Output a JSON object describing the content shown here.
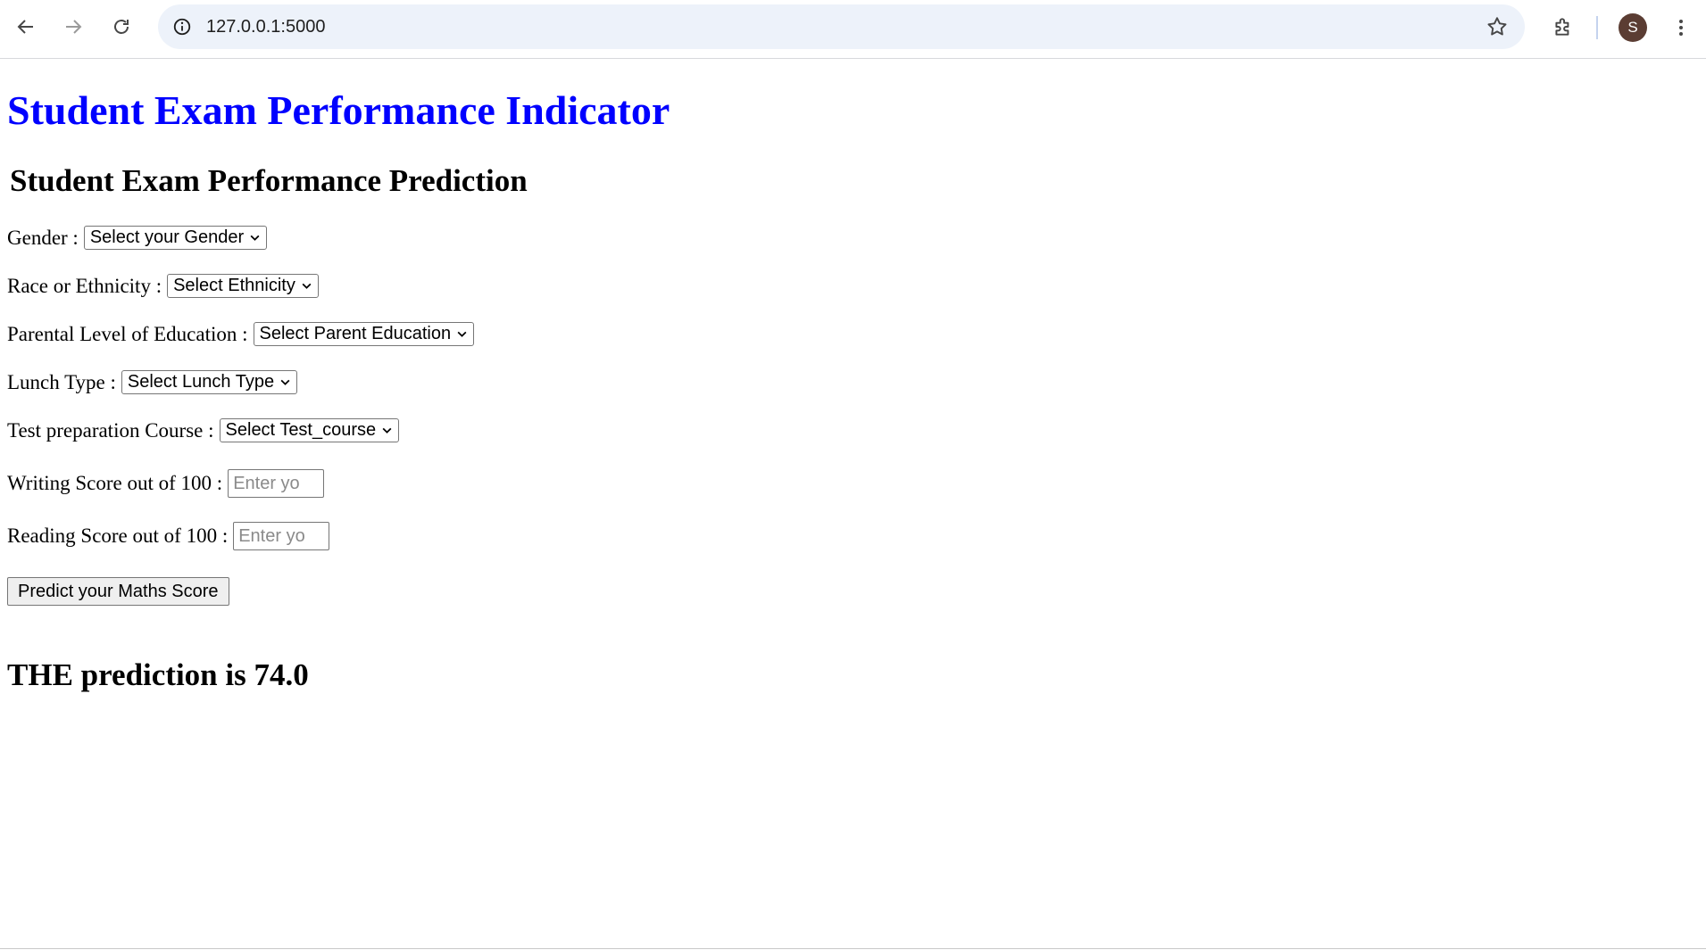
{
  "browser": {
    "url": "127.0.0.1:5000",
    "profile_initial": "S",
    "icons": {
      "back": "arrow-left-icon",
      "forward": "arrow-right-icon",
      "reload": "reload-icon",
      "site_info": "info-icon",
      "bookmark": "star-icon",
      "extensions": "puzzle-icon",
      "menu": "kebab-menu-icon"
    }
  },
  "page": {
    "title": "Student Exam Performance Indicator",
    "subtitle": "Student Exam Performance Prediction",
    "form": {
      "gender_label": "Gender :",
      "gender_value": "Select your Gender",
      "ethnicity_label": "Race or Ethnicity :",
      "ethnicity_value": "Select Ethnicity",
      "parent_edu_label": "Parental Level of Education :",
      "parent_edu_value": "Select Parent Education",
      "lunch_label": "Lunch Type :",
      "lunch_value": "Select Lunch Type",
      "test_course_label": "Test preparation Course :",
      "test_course_value": "Select Test_course",
      "writing_label": "Writing Score out of 100 :",
      "writing_placeholder": "Enter yo",
      "reading_label": "Reading Score out of 100 :",
      "reading_placeholder": "Enter yo",
      "submit_label": "Predict your Maths Score"
    },
    "result": "THE prediction is 74.0"
  },
  "colors": {
    "title": "#0000ff",
    "omnibox_bg": "#edf2fa",
    "avatar_bg": "#5b3d33"
  }
}
